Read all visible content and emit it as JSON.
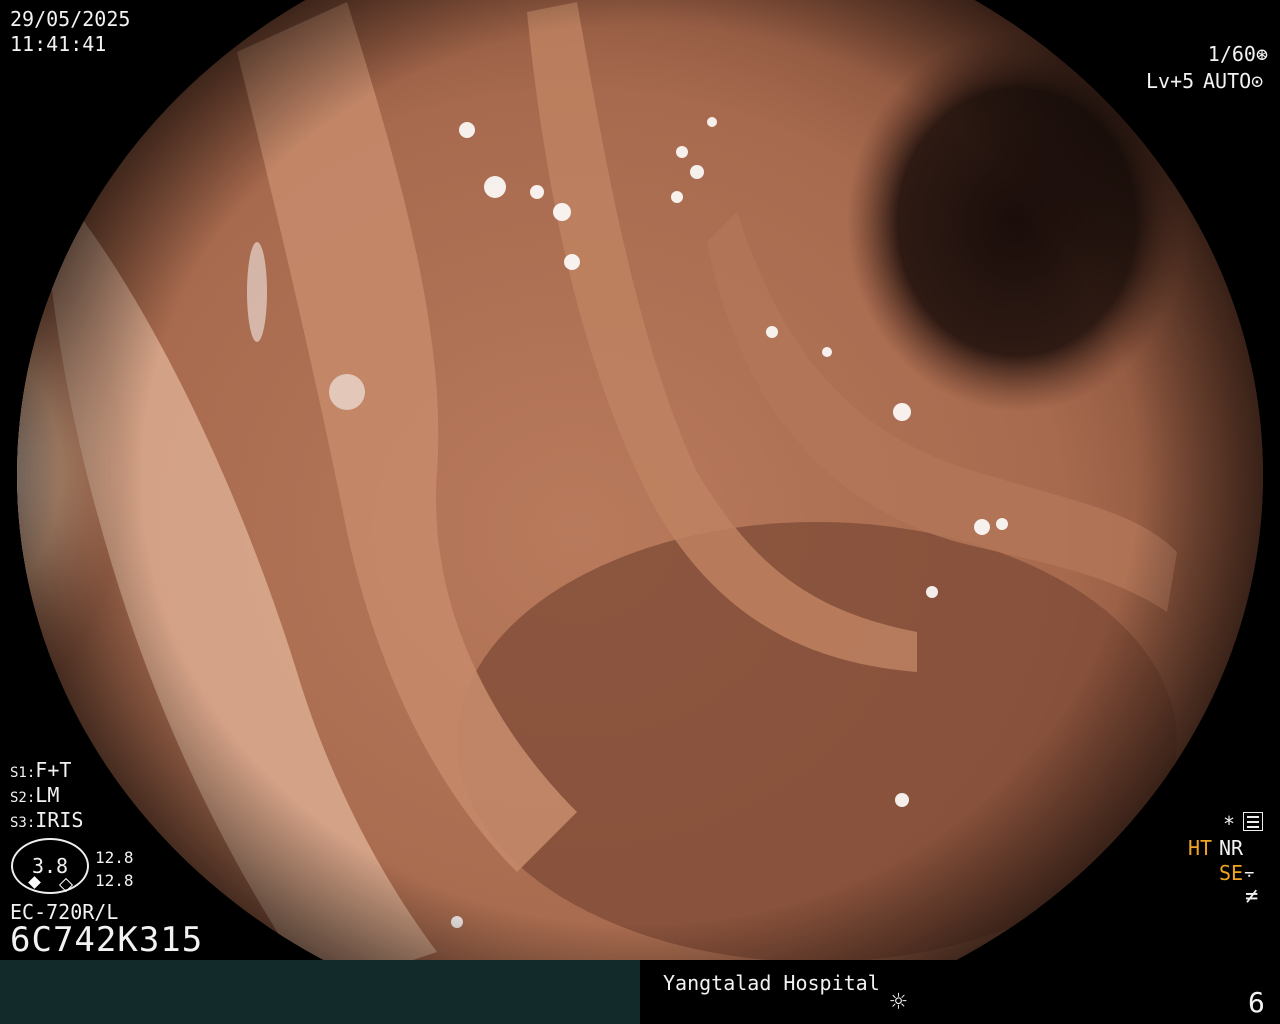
{
  "header": {
    "date": "29/05/2025",
    "time": "11:41:41",
    "shutter": "1/60",
    "level": "Lv+5",
    "mode": "AUTO"
  },
  "settings": {
    "s1_key": "S1:",
    "s1_value": "F+T",
    "s2_key": "S2:",
    "s2_value": "LM",
    "s3_key": "S3:",
    "s3_value": "IRIS",
    "dial_value": "3.8",
    "value_a": "12.8",
    "value_b": "12.8"
  },
  "scope": {
    "model": "EC-720R/L",
    "serial": "6C742K315"
  },
  "indicators": {
    "star": "*",
    "ht": "HT",
    "nr": "NR",
    "se": "SE"
  },
  "footer": {
    "hospital": "Yangtalad Hospital",
    "page": "6"
  },
  "icons": {
    "shutter": "shutter-aperture-icon",
    "auto": "auto-iris-icon",
    "menu": "menu-settings-icon",
    "se": "structure-enhance-icon",
    "flash": "freeze-icon",
    "light": "light-source-icon"
  }
}
